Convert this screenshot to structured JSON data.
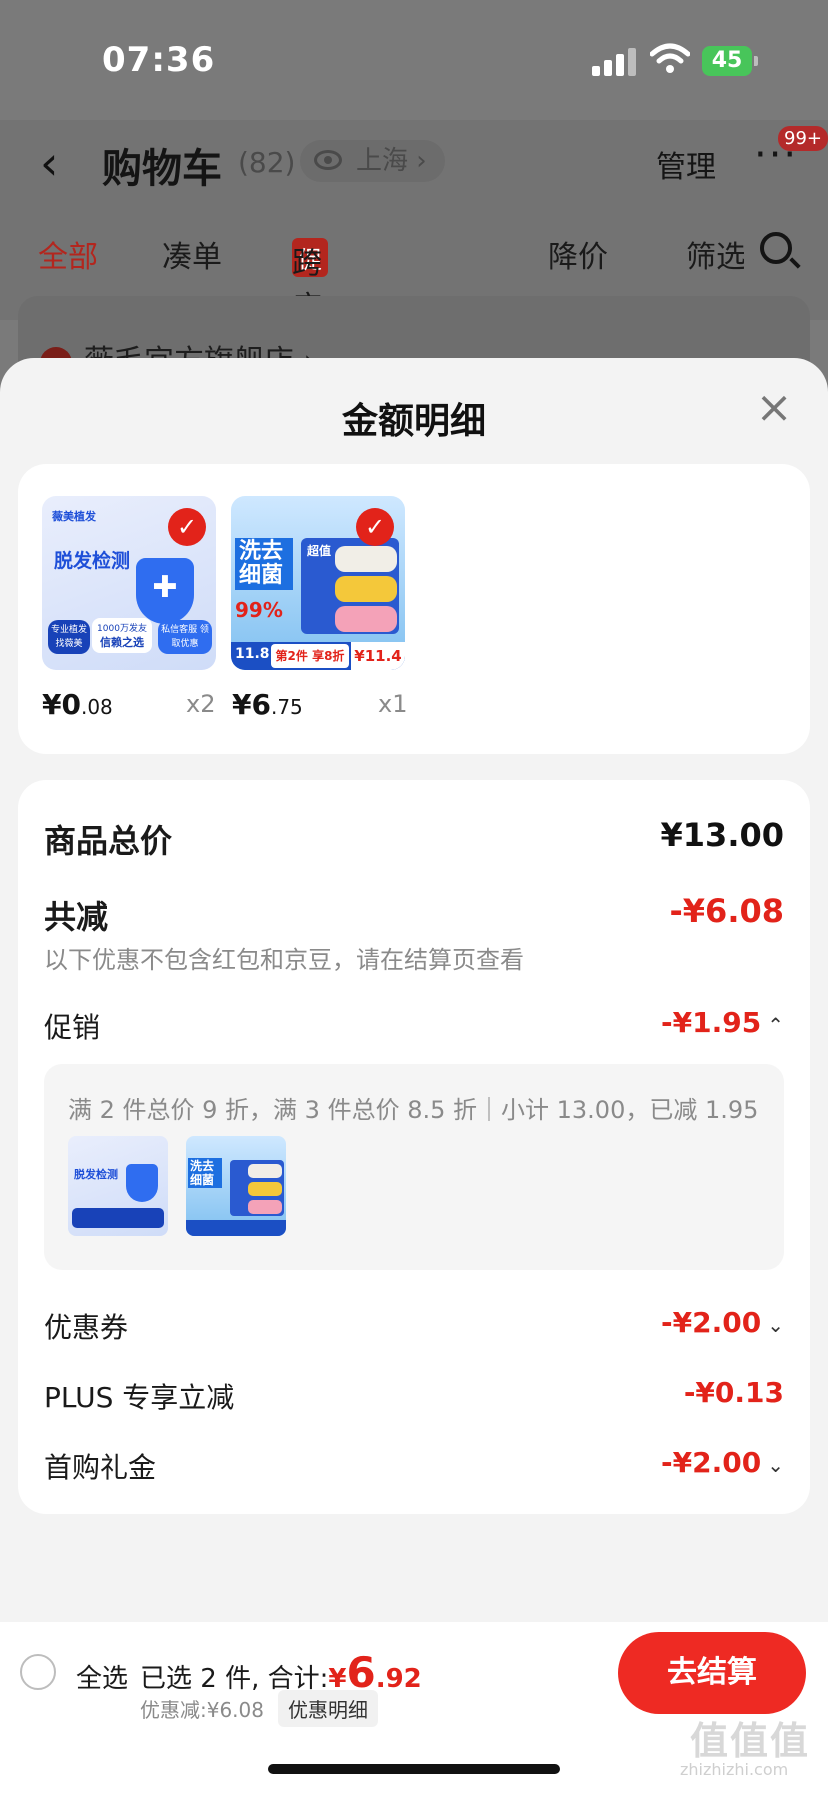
{
  "status": {
    "time": "07:36",
    "battery": "45"
  },
  "header": {
    "title": "购物车",
    "count": "(82)",
    "location": "上海 ›",
    "manage": "管理",
    "more": "···",
    "badge": "99+"
  },
  "tabs": [
    {
      "label": "全部"
    },
    {
      "label": "凑单"
    },
    {
      "label": "跨店满减",
      "tag": "促"
    },
    {
      "label": "降价"
    },
    {
      "label": "筛选"
    }
  ],
  "store": {
    "name": "薇毛宜方旗舰店 ›"
  },
  "sheet": {
    "title": "金额明细",
    "close": "×"
  },
  "products": [
    {
      "price_main": "¥0",
      "price_dec": ".08",
      "qty": "x2",
      "art_brand": "薇美植发",
      "art_title": "脱发检测",
      "art_badge": "1000万发友",
      "art_slogan": "信赖之选",
      "art_side": "私信客服 领取优惠",
      "art_left": "专业植发 找薇美"
    },
    {
      "price_main": "¥6",
      "price_dec": ".75",
      "qty": "x1",
      "art_title": "洗去细菌",
      "art_pct": "99%",
      "art_brand": "超值",
      "art_promo": "第2件 享8折",
      "art_price": "¥11.4",
      "art_left_price": "11.8"
    }
  ],
  "detail": {
    "total_label": "商品总价",
    "total_value": "¥13.00",
    "reduce_label": "共减",
    "reduce_value": "-¥6.08",
    "note": "以下优惠不包含红包和京豆，请在结算页查看",
    "promo_label": "促销",
    "promo_value": "-¥1.95",
    "promo_rule": "满 2 件总价 9 折，满 3 件总价 8.5 折｜小计 13.00，已减 1.95",
    "coupon_label": "优惠券",
    "coupon_value": "-¥2.00",
    "plus_label": "PLUS 专享立减",
    "plus_value": "-¥0.13",
    "gift_label": "首购礼金",
    "gift_value": "-¥2.00"
  },
  "bottom": {
    "select_all": "全选",
    "selected_text": "已选 2 件, 合计:",
    "total_symbol": "¥",
    "total_int": "6",
    "total_dec": ".92",
    "discount_text": "优惠减:¥6.08",
    "detail_btn": "优惠明细",
    "checkout": "去结算"
  },
  "watermark": {
    "text": "值值值",
    "url": "zhizhizhi.com"
  },
  "colors": {
    "accent": "#e2231a",
    "checkout": "#ee2a23"
  }
}
